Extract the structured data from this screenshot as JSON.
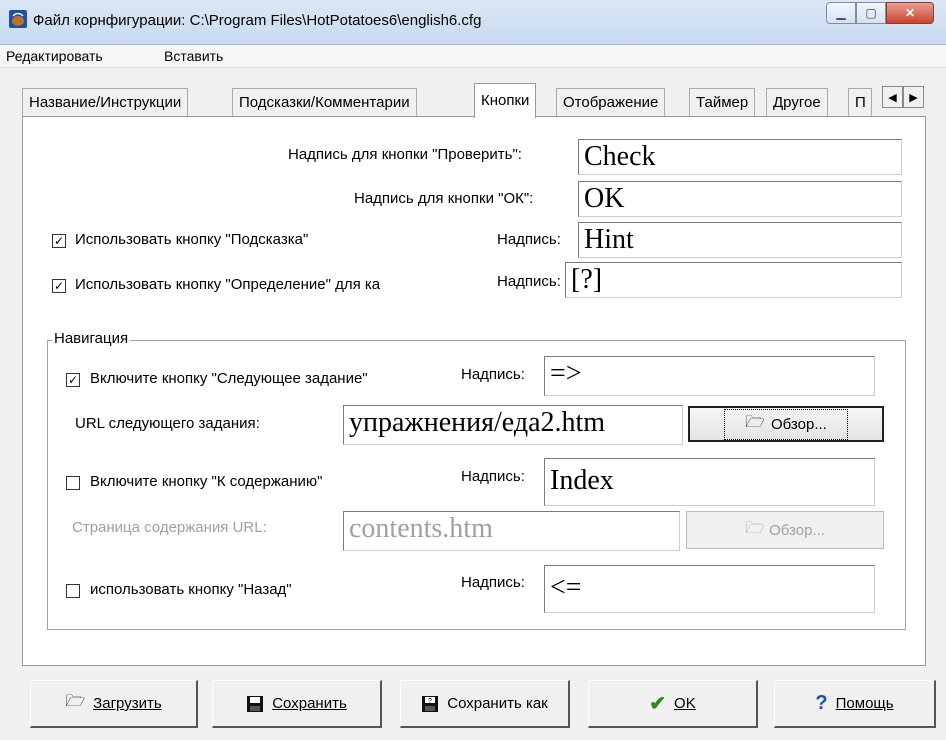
{
  "window": {
    "title": "Файл корнфигурации: C:\\Program Files\\HotPotatoes6\\english6.cfg",
    "min_icon": "minimize-icon",
    "max_icon": "maximize-icon",
    "close_icon": "close-icon"
  },
  "menu": [
    "Редактировать",
    "Вставить"
  ],
  "tabs": [
    {
      "label": "Название/Инструкции"
    },
    {
      "label": "Подсказки/Комментарии"
    },
    {
      "label": "Кнопки"
    },
    {
      "label": "Отображение"
    },
    {
      "label": "Таймер"
    },
    {
      "label": "Другое"
    },
    {
      "label": "П"
    }
  ],
  "buttons_tab": {
    "check_label": "Надпись для кнопки \"Проверить\":",
    "check_value": "Check",
    "ok_label": "Надпись для кнопки \"ОК\":",
    "ok_value": "OK",
    "hint_checkbox": "Использовать кнопку \"Подсказка\"",
    "hint_caption": "Надпись:",
    "hint_value": "Hint",
    "def_checkbox": "Использовать кнопку \"Определение\" для ка",
    "def_caption": "Надпись:",
    "def_value": "[?]",
    "check_mark": "✓"
  },
  "navigation": {
    "title": "Навигация",
    "next_checkbox": "Включите кнопку \"Следующее задание\"",
    "next_caption": "Надпись:",
    "next_value": "=>",
    "next_url_label": "URL следующего задания:",
    "next_url_value": "упражнения/еда2.htm",
    "browse": "Обзор...",
    "contents_checkbox": "Включите кнопку \"К содержанию\"",
    "contents_caption": "Надпись:",
    "contents_value": "Index",
    "contents_url_label": "Страница содержания URL:",
    "contents_url_value": "contents.htm",
    "back_checkbox": "использовать кнопку \"Назад\"",
    "back_caption": "Надпись:",
    "back_value": "<="
  },
  "bottom": {
    "load": "Загрузить",
    "save": "Сохранить",
    "save_as": "Сохранить как",
    "ok": "OK",
    "help": "Помощь"
  }
}
